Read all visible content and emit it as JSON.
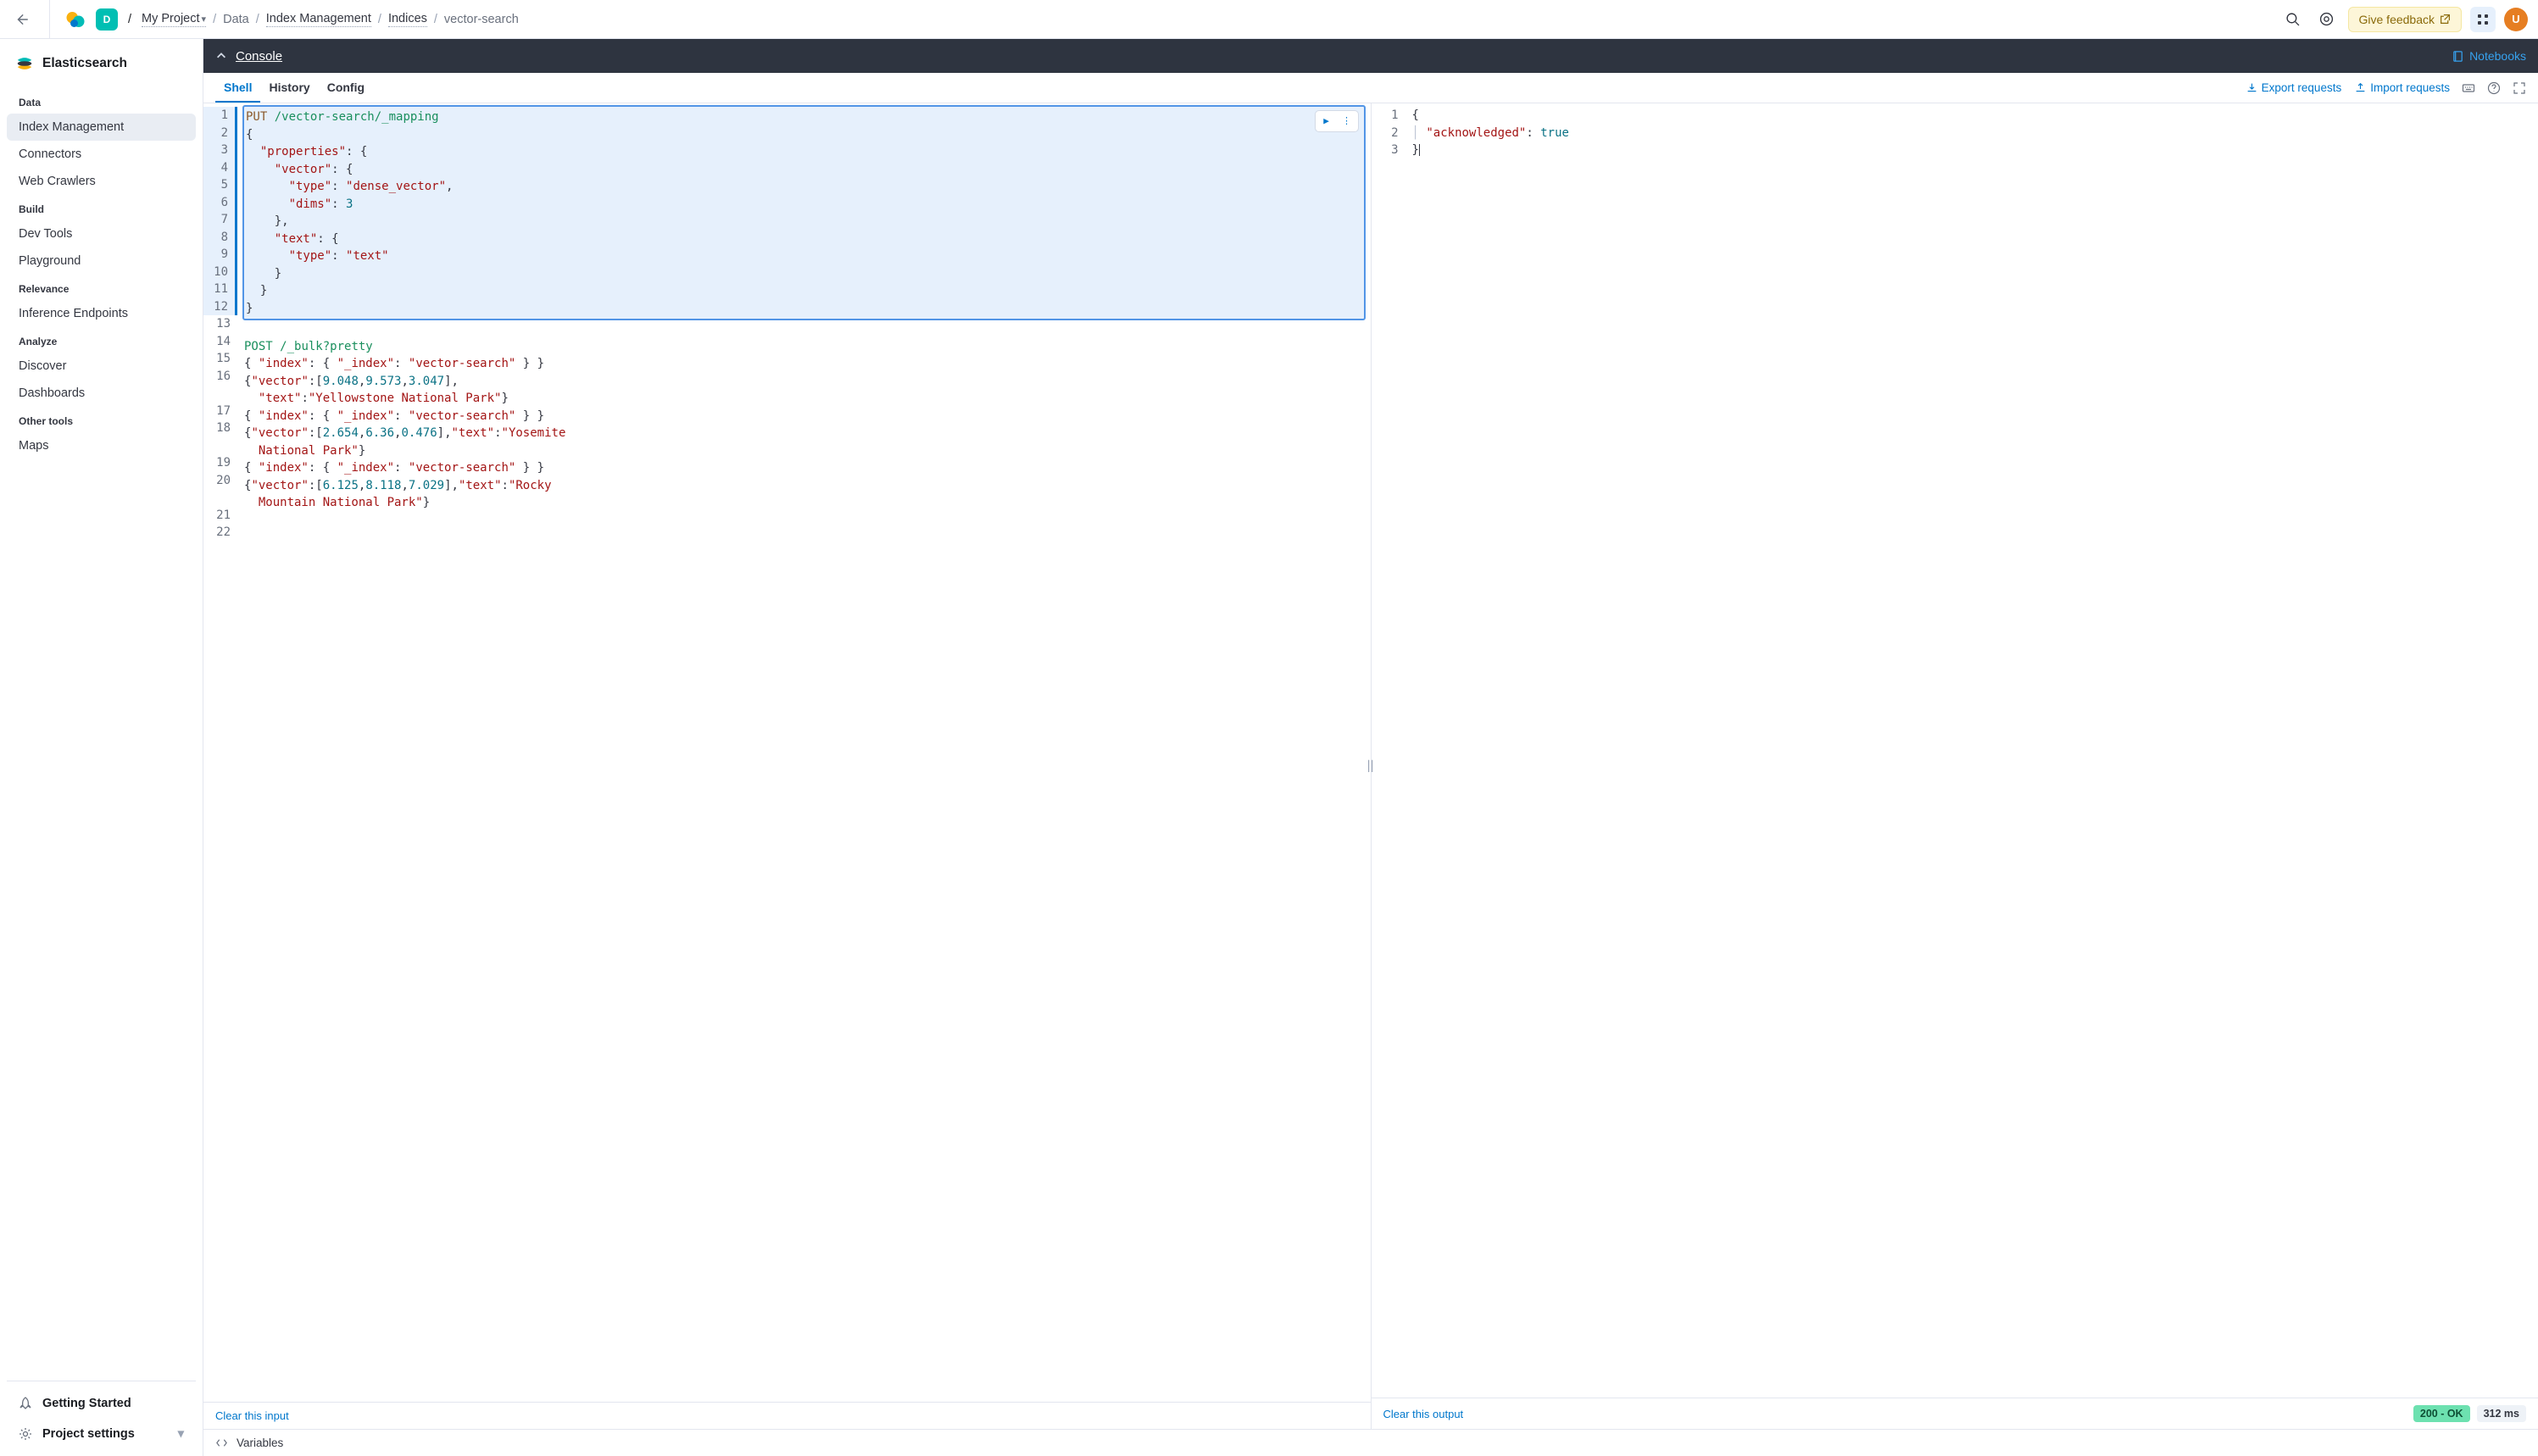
{
  "topbar": {
    "space_initial": "D",
    "breadcrumbs": {
      "project": "My Project",
      "items": [
        "Data",
        "Index Management",
        "Indices"
      ],
      "current": "vector-search"
    },
    "feedback_label": "Give feedback",
    "avatar_initial": "U"
  },
  "sidebar": {
    "title": "Elasticsearch",
    "groups": [
      {
        "label": "Data",
        "items": [
          "Index Management",
          "Connectors",
          "Web Crawlers"
        ],
        "active_index": 0
      },
      {
        "label": "Build",
        "items": [
          "Dev Tools",
          "Playground"
        ]
      },
      {
        "label": "Relevance",
        "items": [
          "Inference Endpoints"
        ]
      },
      {
        "label": "Analyze",
        "items": [
          "Discover",
          "Dashboards"
        ]
      },
      {
        "label": "Other tools",
        "items": [
          "Maps"
        ]
      }
    ],
    "footer": {
      "getting_started": "Getting Started",
      "project_settings": "Project settings"
    }
  },
  "console": {
    "title": "Console",
    "notebooks_label": "Notebooks",
    "tabs": [
      "Shell",
      "History",
      "Config"
    ],
    "active_tab": 0,
    "actions": {
      "export": "Export requests",
      "import": "Import requests"
    },
    "input": {
      "clear_label": "Clear this input",
      "highlighted_range": [
        1,
        12
      ],
      "lines": [
        {
          "n": 1,
          "tokens": [
            [
              "method",
              "PUT"
            ],
            [
              "sp",
              " "
            ],
            [
              "path",
              "/vector-search/_mapping"
            ]
          ]
        },
        {
          "n": 2,
          "tokens": [
            [
              "punc",
              "{"
            ]
          ]
        },
        {
          "n": 3,
          "tokens": [
            [
              "ind",
              "  "
            ],
            [
              "key",
              "\"properties\""
            ],
            [
              "punc",
              ": {"
            ]
          ]
        },
        {
          "n": 4,
          "tokens": [
            [
              "ind",
              "    "
            ],
            [
              "key",
              "\"vector\""
            ],
            [
              "punc",
              ": {"
            ]
          ]
        },
        {
          "n": 5,
          "tokens": [
            [
              "ind",
              "      "
            ],
            [
              "key",
              "\"type\""
            ],
            [
              "punc",
              ": "
            ],
            [
              "str",
              "\"dense_vector\""
            ],
            [
              "punc",
              ","
            ]
          ]
        },
        {
          "n": 6,
          "tokens": [
            [
              "ind",
              "      "
            ],
            [
              "key",
              "\"dims\""
            ],
            [
              "punc",
              ": "
            ],
            [
              "num",
              "3"
            ]
          ]
        },
        {
          "n": 7,
          "tokens": [
            [
              "ind",
              "    "
            ],
            [
              "punc",
              "},"
            ]
          ]
        },
        {
          "n": 8,
          "tokens": [
            [
              "ind",
              "    "
            ],
            [
              "key",
              "\"text\""
            ],
            [
              "punc",
              ": {"
            ]
          ]
        },
        {
          "n": 9,
          "tokens": [
            [
              "ind",
              "      "
            ],
            [
              "key",
              "\"type\""
            ],
            [
              "punc",
              ": "
            ],
            [
              "str",
              "\"text\""
            ]
          ]
        },
        {
          "n": 10,
          "tokens": [
            [
              "ind",
              "    "
            ],
            [
              "punc",
              "}"
            ]
          ]
        },
        {
          "n": 11,
          "tokens": [
            [
              "ind",
              "  "
            ],
            [
              "punc",
              "}"
            ]
          ]
        },
        {
          "n": 12,
          "tokens": [
            [
              "punc",
              "}"
            ]
          ]
        },
        {
          "n": 13,
          "tokens": []
        },
        {
          "n": 14,
          "tokens": [
            [
              "method-post",
              "POST"
            ],
            [
              "sp",
              " "
            ],
            [
              "path",
              "/_bulk?pretty"
            ]
          ]
        },
        {
          "n": 15,
          "tokens": [
            [
              "punc",
              "{ "
            ],
            [
              "key",
              "\"index\""
            ],
            [
              "punc",
              ": { "
            ],
            [
              "key",
              "\"_index\""
            ],
            [
              "punc",
              ": "
            ],
            [
              "str",
              "\"vector-search\""
            ],
            [
              "punc",
              " } }"
            ]
          ]
        },
        {
          "n": 16,
          "tokens": [
            [
              "punc",
              "{"
            ],
            [
              "key",
              "\"vector\""
            ],
            [
              "punc",
              ":["
            ],
            [
              "num",
              "9.048"
            ],
            [
              "punc",
              ","
            ],
            [
              "num",
              "9.573"
            ],
            [
              "punc",
              ","
            ],
            [
              "num",
              "3.047"
            ],
            [
              "punc",
              "],"
            ]
          ],
          "wrap": [
            [
              "ind",
              "  "
            ],
            [
              "key",
              "\"text\""
            ],
            [
              "punc",
              ":"
            ],
            [
              "str",
              "\"Yellowstone National Park\""
            ],
            [
              "punc",
              "}"
            ]
          ]
        },
        {
          "n": 17,
          "tokens": [
            [
              "punc",
              "{ "
            ],
            [
              "key",
              "\"index\""
            ],
            [
              "punc",
              ": { "
            ],
            [
              "key",
              "\"_index\""
            ],
            [
              "punc",
              ": "
            ],
            [
              "str",
              "\"vector-search\""
            ],
            [
              "punc",
              " } }"
            ]
          ]
        },
        {
          "n": 18,
          "tokens": [
            [
              "punc",
              "{"
            ],
            [
              "key",
              "\"vector\""
            ],
            [
              "punc",
              ":["
            ],
            [
              "num",
              "2.654"
            ],
            [
              "punc",
              ","
            ],
            [
              "num",
              "6.36"
            ],
            [
              "punc",
              ","
            ],
            [
              "num",
              "0.476"
            ],
            [
              "punc",
              "],"
            ],
            [
              "key",
              "\"text\""
            ],
            [
              "punc",
              ":"
            ],
            [
              "str",
              "\"Yosemite "
            ]
          ],
          "wrap": [
            [
              "ind",
              "  "
            ],
            [
              "str",
              "National Park\""
            ],
            [
              "punc",
              "}"
            ]
          ]
        },
        {
          "n": 19,
          "tokens": [
            [
              "punc",
              "{ "
            ],
            [
              "key",
              "\"index\""
            ],
            [
              "punc",
              ": { "
            ],
            [
              "key",
              "\"_index\""
            ],
            [
              "punc",
              ": "
            ],
            [
              "str",
              "\"vector-search\""
            ],
            [
              "punc",
              " } }"
            ]
          ]
        },
        {
          "n": 20,
          "tokens": [
            [
              "punc",
              "{"
            ],
            [
              "key",
              "\"vector\""
            ],
            [
              "punc",
              ":["
            ],
            [
              "num",
              "6.125"
            ],
            [
              "punc",
              ","
            ],
            [
              "num",
              "8.118"
            ],
            [
              "punc",
              ","
            ],
            [
              "num",
              "7.029"
            ],
            [
              "punc",
              "],"
            ],
            [
              "key",
              "\"text\""
            ],
            [
              "punc",
              ":"
            ],
            [
              "str",
              "\"Rocky "
            ]
          ],
          "wrap": [
            [
              "ind",
              "  "
            ],
            [
              "str",
              "Mountain National Park\""
            ],
            [
              "punc",
              "}"
            ]
          ]
        },
        {
          "n": 21,
          "tokens": []
        },
        {
          "n": 22,
          "tokens": []
        }
      ]
    },
    "output": {
      "clear_label": "Clear this output",
      "status": "200 - OK",
      "time": "312 ms",
      "lines": [
        {
          "n": 1,
          "tokens": [
            [
              "punc",
              "{"
            ]
          ]
        },
        {
          "n": 2,
          "tokens": [
            [
              "guide",
              "│ "
            ],
            [
              "key",
              "\"acknowledged\""
            ],
            [
              "punc",
              ": "
            ],
            [
              "bool",
              "true"
            ]
          ]
        },
        {
          "n": 3,
          "tokens": [
            [
              "punc",
              "}"
            ],
            [
              "cursor",
              ""
            ]
          ]
        }
      ]
    },
    "variables_label": "Variables"
  }
}
